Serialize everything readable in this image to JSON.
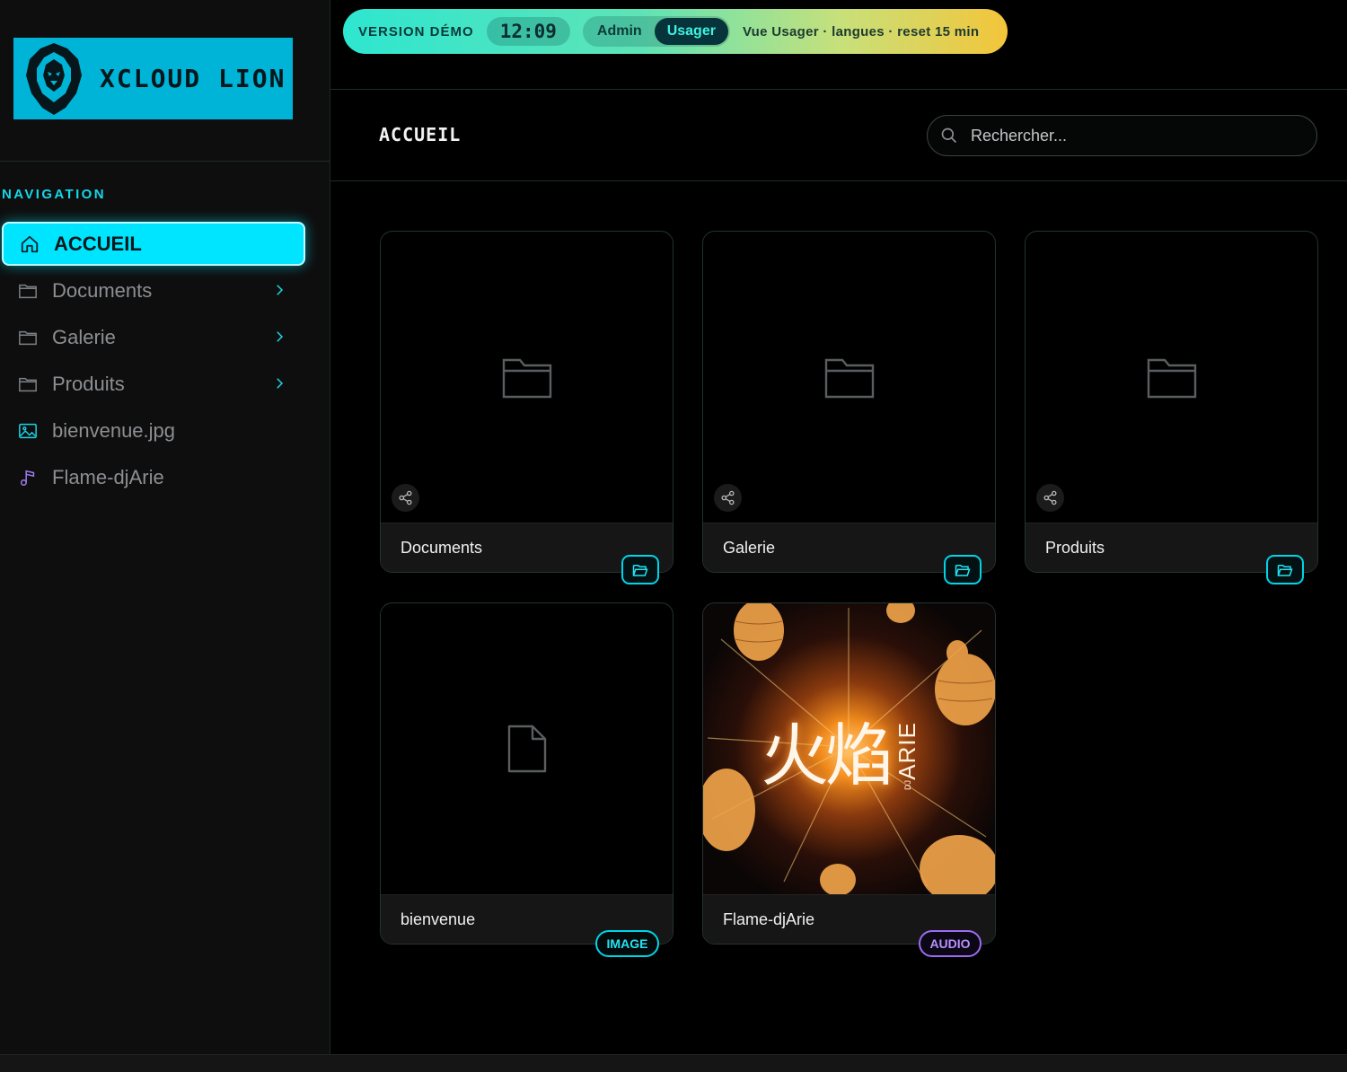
{
  "demo": {
    "label": "VERSION DÉMO",
    "time": "12:09",
    "modes": [
      "Admin",
      "Usager"
    ],
    "active_mode": "Usager",
    "info": "Vue Usager · langues · reset 15 min"
  },
  "brand": {
    "name": "XCLOUD LION"
  },
  "sidebar": {
    "heading": "NAVIGATION",
    "items": [
      {
        "label": "ACCUEIL",
        "icon": "home-icon",
        "active": true
      },
      {
        "label": "Documents",
        "icon": "folder-icon",
        "expandable": true
      },
      {
        "label": "Galerie",
        "icon": "folder-icon",
        "expandable": true
      },
      {
        "label": "Produits",
        "icon": "folder-icon",
        "expandable": true
      },
      {
        "label": "bienvenue.jpg",
        "icon": "image-icon"
      },
      {
        "label": "Flame-djArie",
        "icon": "music-icon"
      }
    ]
  },
  "header": {
    "title": "ACCUEIL",
    "search_placeholder": "Rechercher..."
  },
  "cards": [
    {
      "name": "Documents",
      "kind": "folder"
    },
    {
      "name": "Galerie",
      "kind": "folder"
    },
    {
      "name": "Produits",
      "kind": "folder"
    },
    {
      "name": "bienvenue",
      "kind": "file",
      "badge": "IMAGE"
    },
    {
      "name": "Flame-djArie",
      "kind": "audio",
      "badge": "AUDIO"
    }
  ],
  "artwork": {
    "glyphs": "火焰",
    "side_text": "ARIE",
    "side_small": "DJ"
  },
  "colors": {
    "accent": "#00e5ff",
    "audio": "#9b6cf0",
    "background": "#000000"
  }
}
